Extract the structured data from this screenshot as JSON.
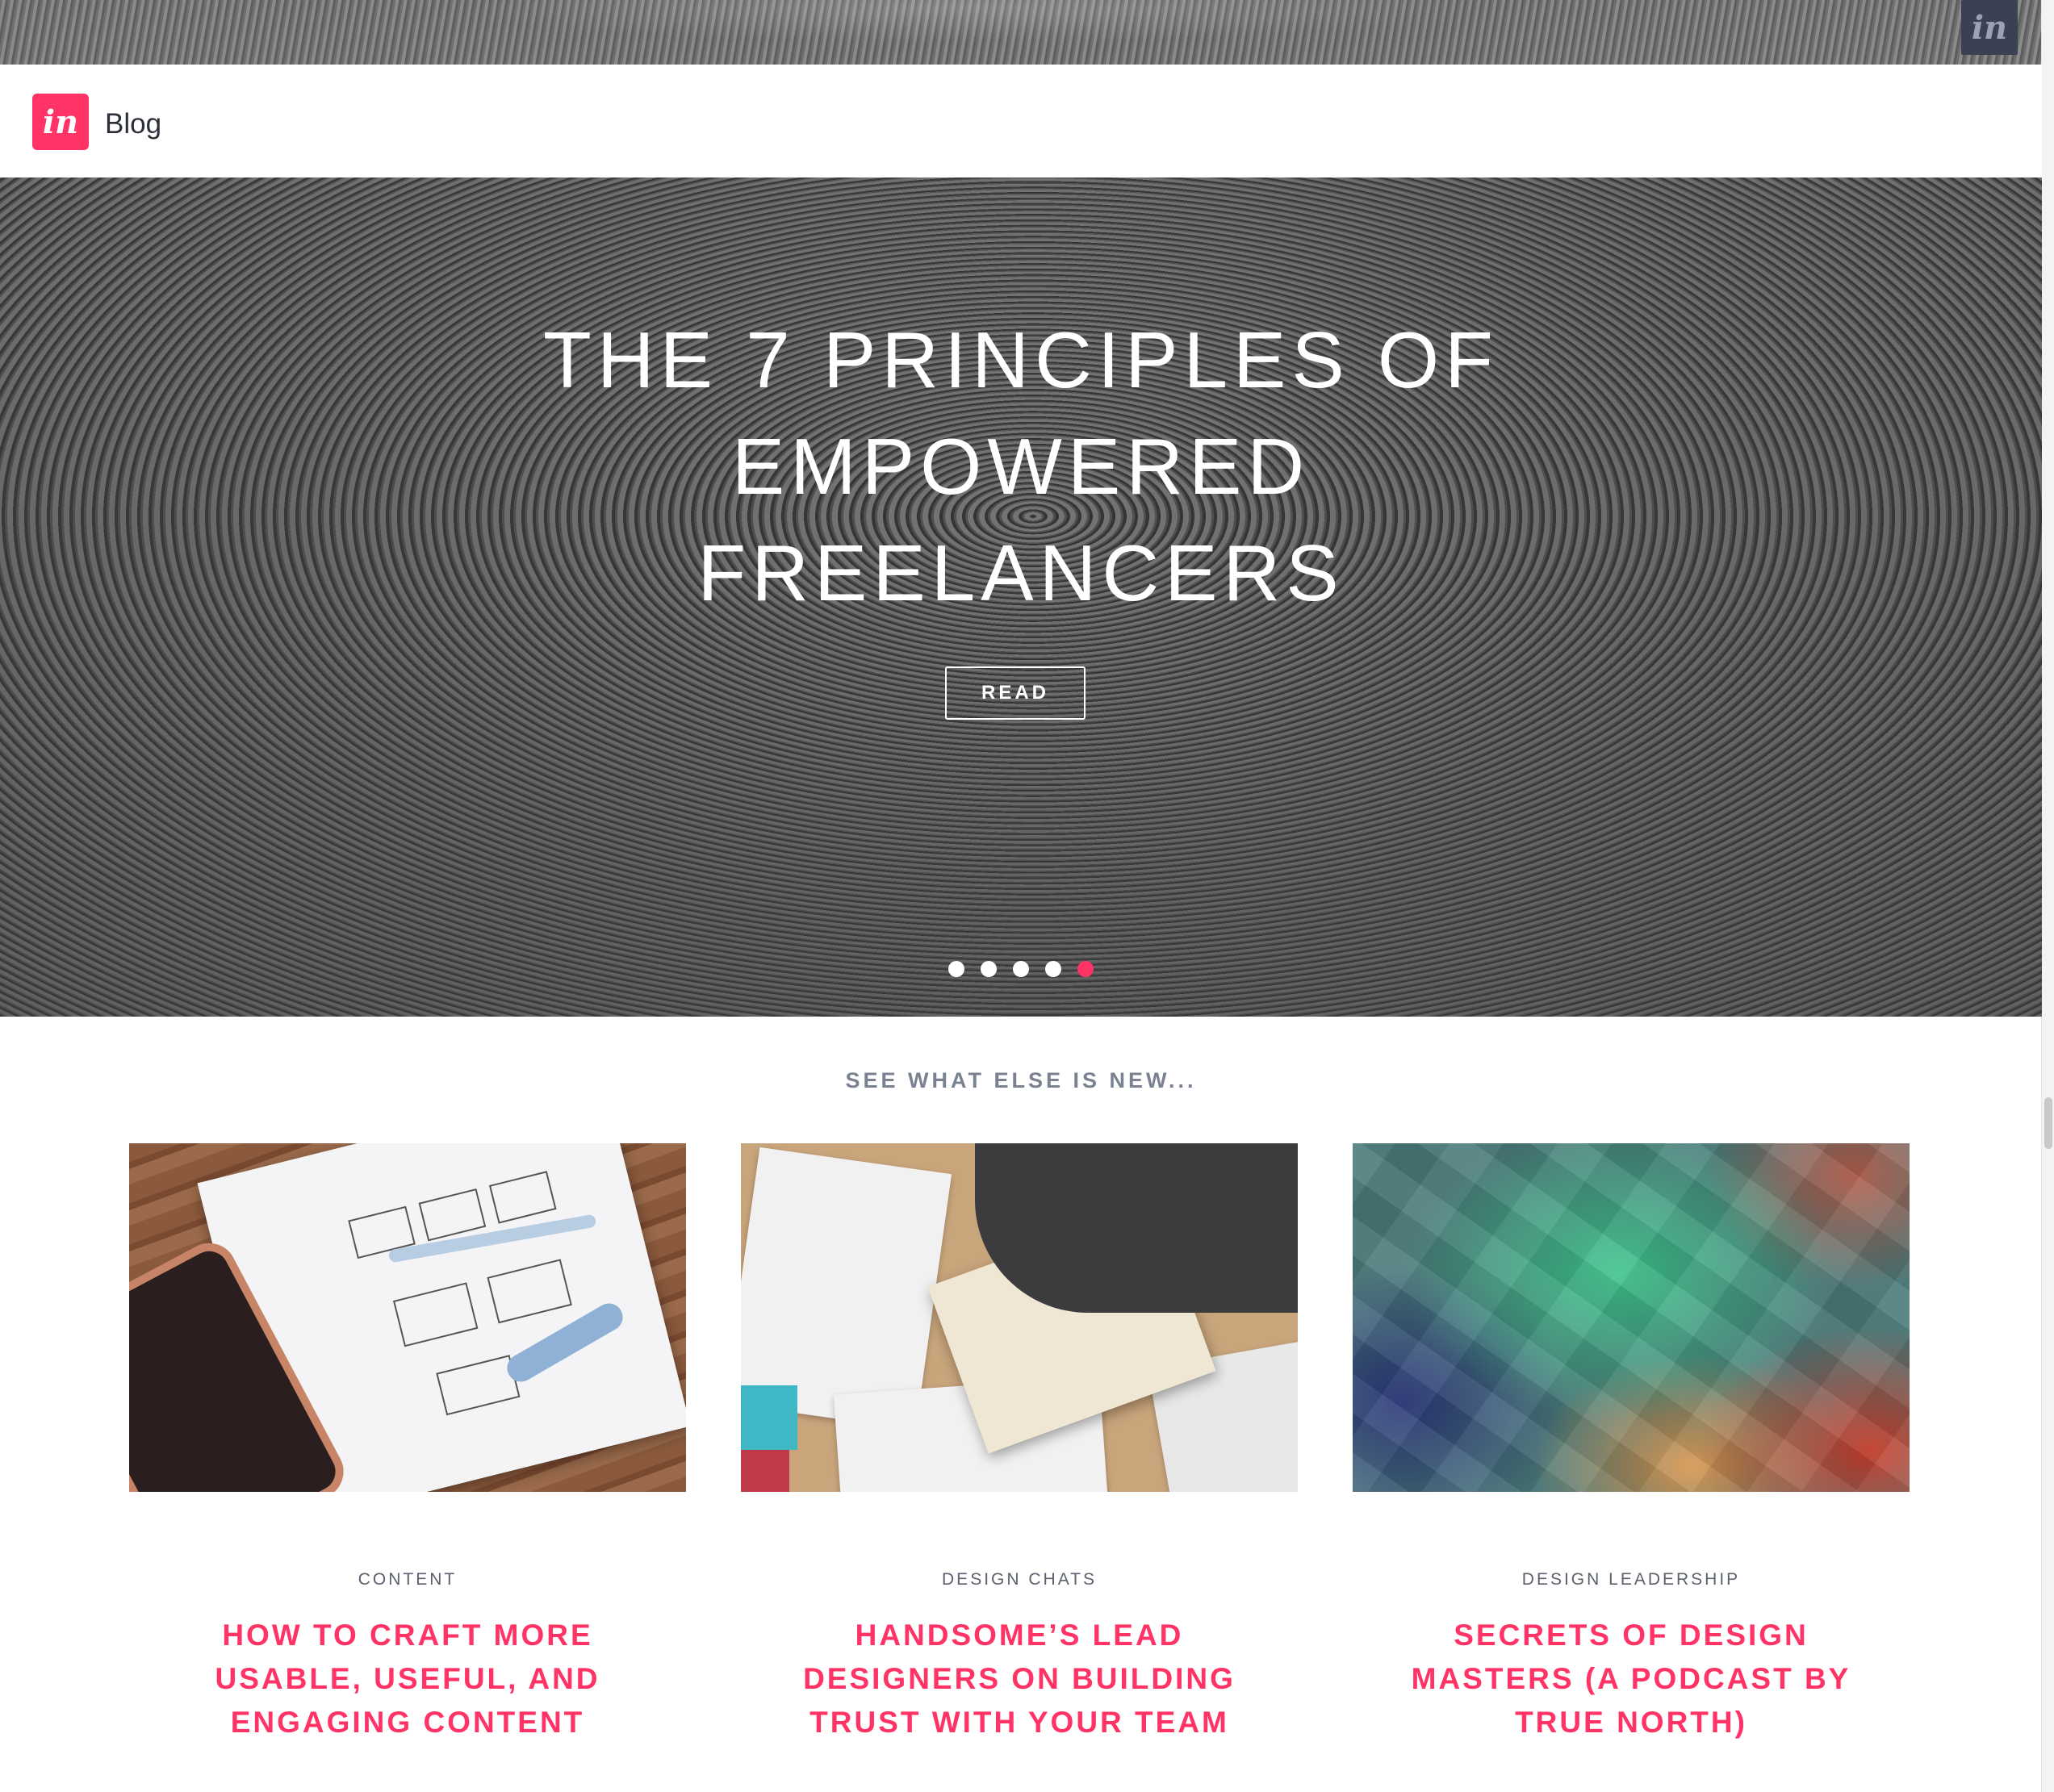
{
  "brand": {
    "badge_glyph": "in",
    "logo_glyph": "in",
    "blog_label": "Blog",
    "accent": "#ff3366"
  },
  "hero": {
    "title_lines": [
      "THE 7 PRINCIPLES OF",
      "EMPOWERED",
      "FREELANCERS"
    ],
    "read_label": "READ",
    "slides_total": 5,
    "active_slide": 5
  },
  "section": {
    "heading": "SEE WHAT ELSE IS NEW..."
  },
  "cards": [
    {
      "category": "CONTENT",
      "title": "HOW TO CRAFT MORE USABLE, USEFUL, AND ENGAGING CONTENT",
      "image": "notebook-wireframe-image"
    },
    {
      "category": "DESIGN CHATS",
      "title": "HANDSOME’S LEAD DESIGNERS ON BUILDING TRUST WITH YOUR TEAM",
      "image": "sketches-table-image"
    },
    {
      "category": "DESIGN LEADERSHIP",
      "title": "SECRETS OF DESIGN MASTERS (A PODCAST BY TRUE NORTH)",
      "image": "polygon-gradient-image"
    }
  ]
}
